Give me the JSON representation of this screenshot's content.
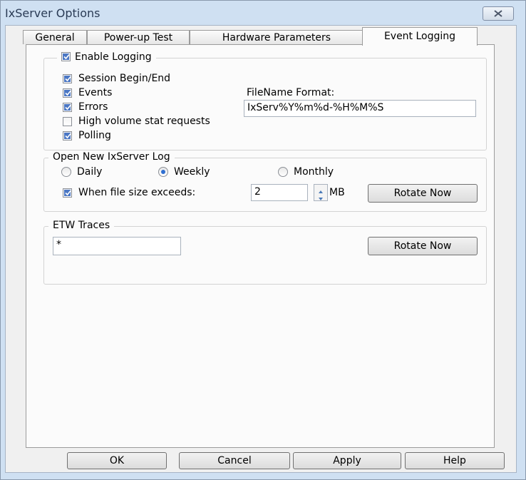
{
  "window": {
    "title": "IxServer Options"
  },
  "tabs": [
    {
      "label": "General",
      "active": false
    },
    {
      "label": "Power-up Test",
      "active": false
    },
    {
      "label": "Hardware Parameters",
      "active": false
    },
    {
      "label": "Event Logging",
      "active": true
    }
  ],
  "logging": {
    "enable_label": "Enable Logging",
    "enable_checked": true,
    "options": [
      {
        "label": "Session Begin/End",
        "checked": true
      },
      {
        "label": "Events",
        "checked": true
      },
      {
        "label": "Errors",
        "checked": true
      },
      {
        "label": "High volume stat requests",
        "checked": false
      },
      {
        "label": "Polling",
        "checked": true
      }
    ],
    "filename_format_label": "FileName Format:",
    "filename_format_value": "IxServ%Y%m%d-%H%M%S"
  },
  "log_rotation": {
    "group_label": "Open New IxServer Log",
    "radios": [
      {
        "label": "Daily",
        "selected": false
      },
      {
        "label": "Weekly",
        "selected": true
      },
      {
        "label": "Monthly",
        "selected": false
      }
    ],
    "size_label": "When file size exceeds:",
    "size_checked": true,
    "size_value": "2",
    "size_unit": "MB",
    "rotate_label": "Rotate Now"
  },
  "etw": {
    "group_label": "ETW Traces",
    "value": "*",
    "rotate_label": "Rotate Now"
  },
  "footer": {
    "ok": "OK",
    "cancel": "Cancel",
    "apply": "Apply",
    "help": "Help"
  },
  "colors": {
    "check_fill": "#4b77c4",
    "radio_dot": "#2f6fd1",
    "frame": "#cfe0f2"
  }
}
